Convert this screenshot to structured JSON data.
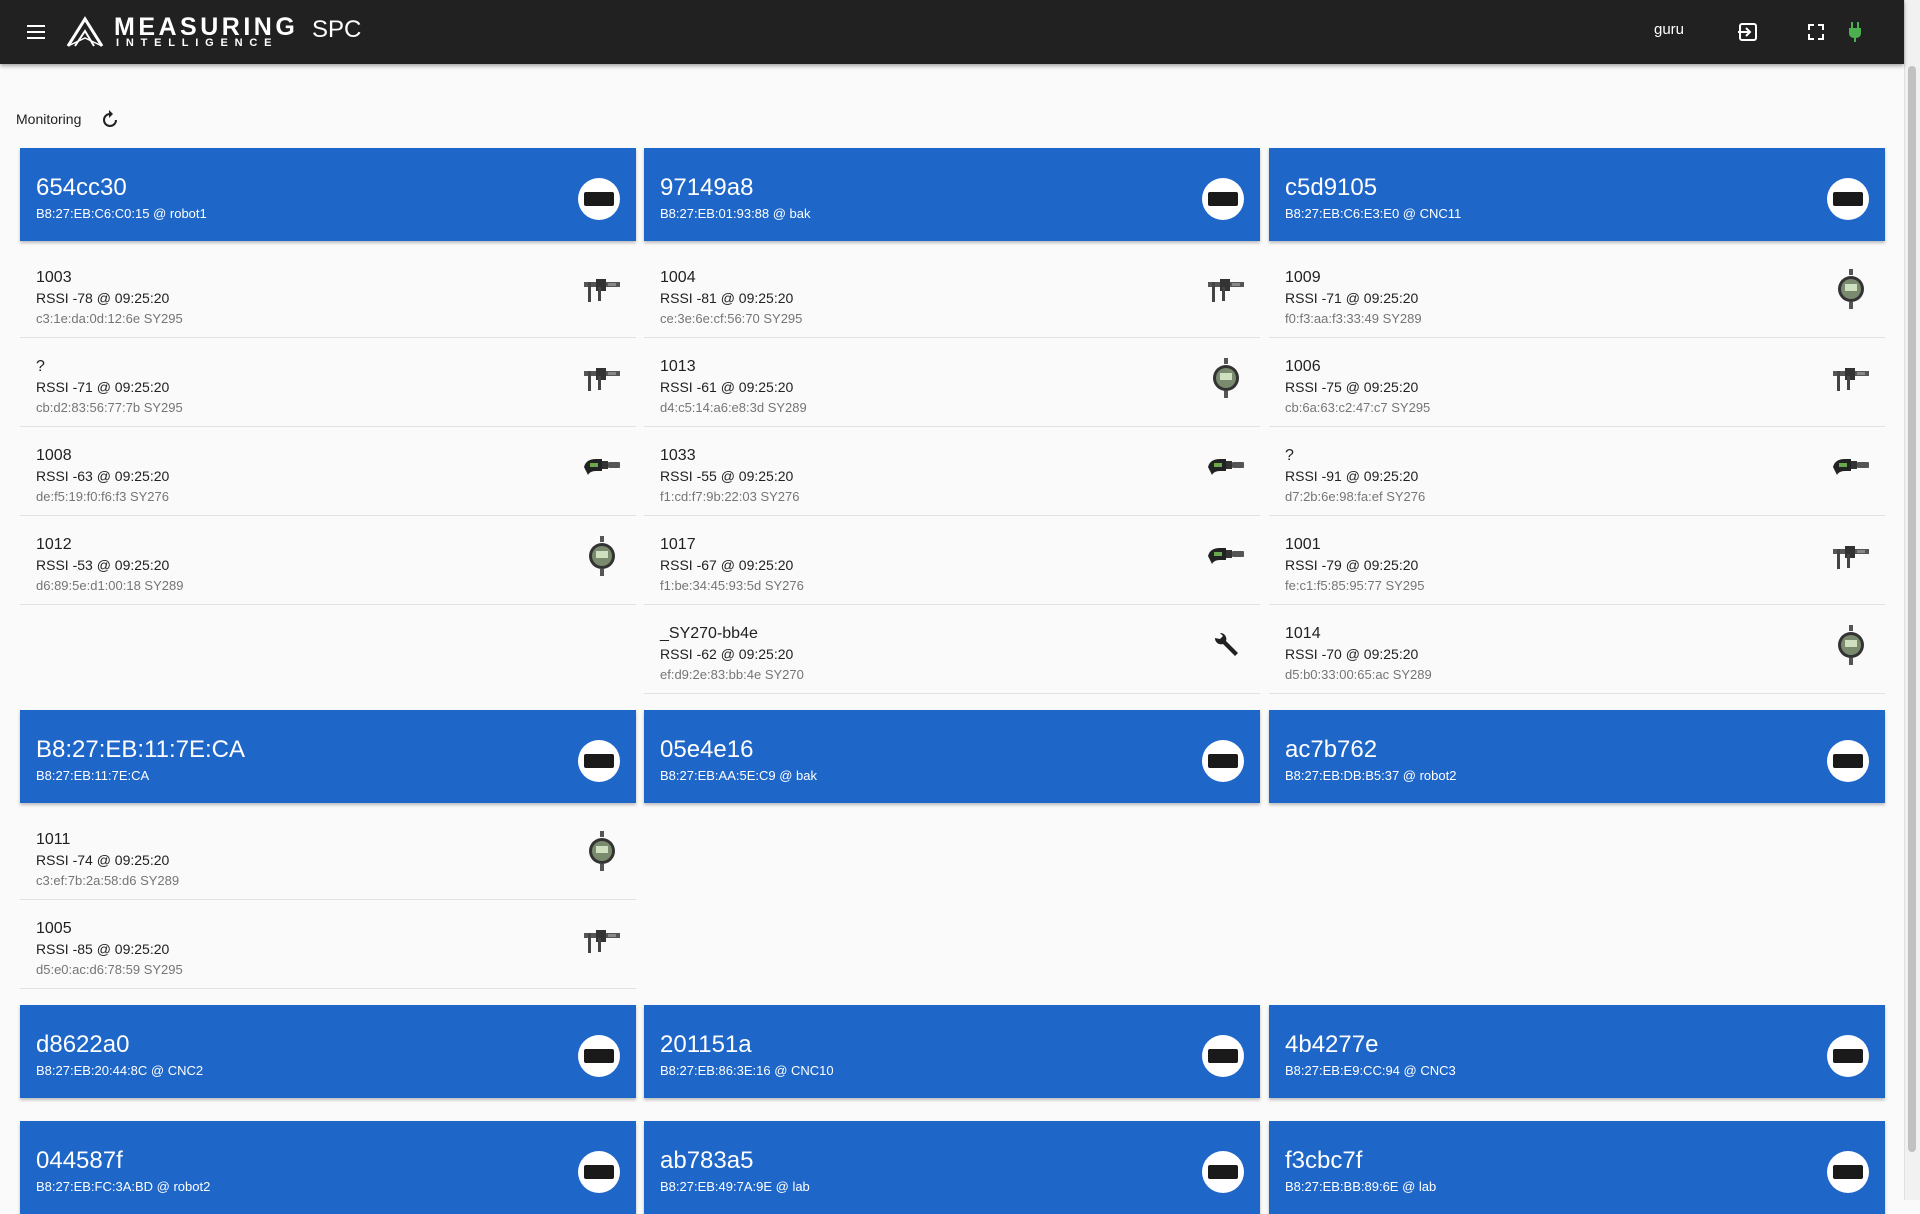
{
  "header": {
    "logo_line1": "MEASURING",
    "logo_line2": "INTELLIGENCE",
    "app_name": "SPC",
    "user": "guru",
    "status_color": "#4caf50"
  },
  "toolbar": {
    "monitoring_label": "Monitoring"
  },
  "colors": {
    "card_blue": "#1e66c8",
    "topbar": "#212121"
  },
  "gateways": [
    {
      "title": "654cc30",
      "subtitle": "B8:27:EB:C6:C0:15 @ robot1",
      "devices": [
        {
          "name": "1003",
          "rssi": "RSSI -78 @ 09:25:20",
          "mac": "c3:1e:da:0d:12:6e SY295",
          "icon": "caliper-icon"
        },
        {
          "name": "?",
          "rssi": "RSSI -71 @ 09:25:20",
          "mac": "cb:d2:83:56:77:7b SY295",
          "icon": "caliper-icon"
        },
        {
          "name": "1008",
          "rssi": "RSSI -63 @ 09:25:20",
          "mac": "de:f5:19:f0:f6:f3 SY276",
          "icon": "micrometer-icon"
        },
        {
          "name": "1012",
          "rssi": "RSSI -53 @ 09:25:20",
          "mac": "d6:89:5e:d1:00:18 SY289",
          "icon": "dial-indicator-icon"
        }
      ]
    },
    {
      "title": "97149a8",
      "subtitle": "B8:27:EB:01:93:88 @ bak",
      "devices": [
        {
          "name": "1004",
          "rssi": "RSSI -81 @ 09:25:20",
          "mac": "ce:3e:6e:cf:56:70 SY295",
          "icon": "caliper-icon"
        },
        {
          "name": "1013",
          "rssi": "RSSI -61 @ 09:25:20",
          "mac": "d4:c5:14:a6:e8:3d SY289",
          "icon": "dial-indicator-icon"
        },
        {
          "name": "1033",
          "rssi": "RSSI -55 @ 09:25:20",
          "mac": "f1:cd:f7:9b:22:03 SY276",
          "icon": "micrometer-icon"
        },
        {
          "name": "1017",
          "rssi": "RSSI -67 @ 09:25:20",
          "mac": "f1:be:34:45:93:5d SY276",
          "icon": "micrometer-icon"
        },
        {
          "name": "_SY270-bb4e",
          "rssi": "RSSI -62 @ 09:25:20",
          "mac": "ef:d9:2e:83:bb:4e SY270",
          "icon": "wrench-icon"
        }
      ]
    },
    {
      "title": "c5d9105",
      "subtitle": "B8:27:EB:C6:E3:E0 @ CNC11",
      "devices": [
        {
          "name": "1009",
          "rssi": "RSSI -71 @ 09:25:20",
          "mac": "f0:f3:aa:f3:33:49 SY289",
          "icon": "dial-indicator-icon"
        },
        {
          "name": "1006",
          "rssi": "RSSI -75 @ 09:25:20",
          "mac": "cb:6a:63:c2:47:c7 SY295",
          "icon": "caliper-icon"
        },
        {
          "name": "?",
          "rssi": "RSSI -91 @ 09:25:20",
          "mac": "d7:2b:6e:98:fa:ef SY276",
          "icon": "micrometer-icon"
        },
        {
          "name": "1001",
          "rssi": "RSSI -79 @ 09:25:20",
          "mac": "fe:c1:f5:85:95:77 SY295",
          "icon": "caliper-icon"
        },
        {
          "name": "1014",
          "rssi": "RSSI -70 @ 09:25:20",
          "mac": "d5:b0:33:00:65:ac SY289",
          "icon": "dial-indicator-icon"
        }
      ]
    },
    {
      "title": "B8:27:EB:11:7E:CA",
      "subtitle": "B8:27:EB:11:7E:CA",
      "devices": [
        {
          "name": "1011",
          "rssi": "RSSI -74 @ 09:25:20",
          "mac": "c3:ef:7b:2a:58:d6 SY289",
          "icon": "dial-indicator-icon"
        },
        {
          "name": "1005",
          "rssi": "RSSI -85 @ 09:25:20",
          "mac": "d5:e0:ac:d6:78:59 SY295",
          "icon": "caliper-icon"
        }
      ]
    },
    {
      "title": "05e4e16",
      "subtitle": "B8:27:EB:AA:5E:C9 @ bak",
      "devices": []
    },
    {
      "title": "ac7b762",
      "subtitle": "B8:27:EB:DB:B5:37 @ robot2",
      "devices": []
    },
    {
      "title": "d8622a0",
      "subtitle": "B8:27:EB:20:44:8C @ CNC2",
      "devices": []
    },
    {
      "title": "201151a",
      "subtitle": "B8:27:EB:86:3E:16 @ CNC10",
      "devices": []
    },
    {
      "title": "4b4277e",
      "subtitle": "B8:27:EB:E9:CC:94 @ CNC3",
      "devices": []
    },
    {
      "title": "044587f",
      "subtitle": "B8:27:EB:FC:3A:BD @ robot2",
      "devices": []
    },
    {
      "title": "ab783a5",
      "subtitle": "B8:27:EB:49:7A:9E @ lab",
      "devices": []
    },
    {
      "title": "f3cbc7f",
      "subtitle": "B8:27:EB:BB:89:6E @ lab",
      "devices": []
    }
  ]
}
